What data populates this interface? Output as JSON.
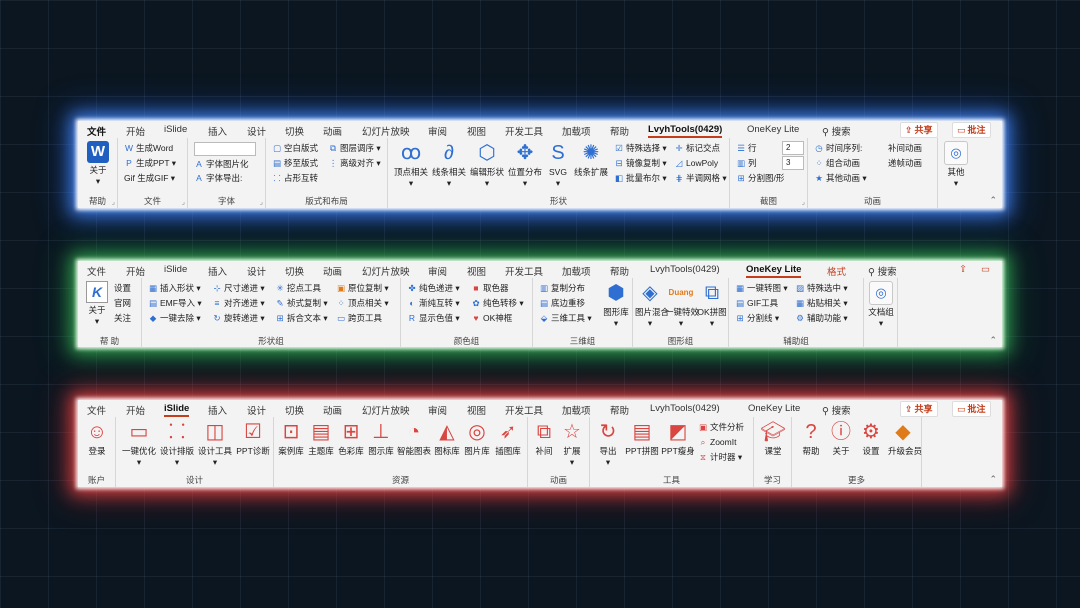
{
  "r1": {
    "tabs": [
      "文件",
      "开始",
      "iSlide",
      "插入",
      "设计",
      "切换",
      "动画",
      "幻灯片放映",
      "审阅",
      "视图",
      "开发工具",
      "加载项",
      "帮助",
      "LvyhTools(0429)",
      "OneKey Lite"
    ],
    "search": "搜索",
    "share": "共享",
    "comment": "批注",
    "groups": {
      "help": "帮助",
      "file": "文件",
      "font": "字体",
      "layout": "版式和布局",
      "shape": "形状",
      "screenshot": "截图",
      "anim": "动画"
    },
    "help": {
      "about": "关于"
    },
    "file": {
      "word": "生成Word",
      "ppt": "生成PPT",
      "gif": "Gif 生成GIF"
    },
    "font": {
      "select": "",
      "pic": "字体图片化",
      "export": "字体导出:"
    },
    "layout": {
      "blank": "空白版式",
      "move": "移至版式",
      "swap": "占形互转",
      "layer": "图层调序",
      "align": "离级对齐"
    },
    "shape": {
      "vertex": "顶点相关",
      "line": "线条相关",
      "edit": "编辑形状",
      "pos": "位置分布",
      "svg": "SVG",
      "expand": "线条扩展",
      "special": "特殊选择",
      "mirror": "镜像复制",
      "bool": "批量布尔",
      "mark": "标记交点",
      "lowpoly": "LowPoly",
      "grid": "半调网格"
    },
    "shot": {
      "row": "行",
      "col": "列",
      "split": "分割图/形",
      "rowval": "2",
      "colval": "3"
    },
    "anim": {
      "timeline": "时间序列:",
      "combo": "组合动画",
      "other": "其他动画",
      "tween": "补间动画",
      "chain": "递帧动画"
    },
    "more": {
      "other": "其他"
    }
  },
  "r2": {
    "tabs": [
      "文件",
      "开始",
      "iSlide",
      "插入",
      "设计",
      "切换",
      "动画",
      "幻灯片放映",
      "审阅",
      "视图",
      "开发工具",
      "加载项",
      "帮助",
      "LvyhTools(0429)",
      "OneKey Lite",
      "格式"
    ],
    "search": "搜索",
    "groups": {
      "help": "帮 助",
      "shape": "形状组",
      "color": "颜色组",
      "three": "三维组",
      "image": "图形组",
      "aux": "辅助组"
    },
    "help": {
      "about": "关于",
      "settings": "设置",
      "site": "官网",
      "follow": "关注"
    },
    "shape": {
      "insert": "插入形状",
      "emf": "EMF导入",
      "remove": "一键去除",
      "size": "尺寸递进",
      "alignp": "对齐递进",
      "rotate": "旋转递进",
      "cut": "挖点工具",
      "style": "祯式复制",
      "split": "拆合文本",
      "origin": "原位复制",
      "vertex": "顶点相关",
      "page": "跨页工具"
    },
    "color": {
      "pure": "纯色递进",
      "grad": "渐纯互转",
      "show": "显示色值",
      "pick": "取色器",
      "shift": "纯色转移",
      "ok": "OK神框"
    },
    "three": {
      "copy": "复制分布",
      "edge": "底边重移",
      "tool": "三维工具",
      "lib": "图形库"
    },
    "image": {
      "mix": "图片混合",
      "oneclick": "一键特效",
      "okpuzzle": "OK拼图",
      "duang": "Duang"
    },
    "aux": {
      "convert": "一键转图",
      "gif": "GIF工具",
      "sep": "分割线",
      "special": "特殊选中",
      "paste": "粘贴相关",
      "func": "辅助功能"
    },
    "doc": {
      "label": "文档组"
    }
  },
  "r3": {
    "tabs": [
      "文件",
      "开始",
      "iSlide",
      "插入",
      "设计",
      "切换",
      "动画",
      "幻灯片放映",
      "审阅",
      "视图",
      "开发工具",
      "加载项",
      "帮助",
      "LvyhTools(0429)",
      "OneKey Lite"
    ],
    "search": "搜索",
    "share": "共享",
    "comment": "批注",
    "groups": {
      "account": "账户",
      "design": "设计",
      "res": "资源",
      "anim": "动画",
      "tool": "工具",
      "learn": "学习",
      "more": "更多"
    },
    "account": {
      "login": "登录"
    },
    "design": {
      "opt": "一键优化",
      "arrange": "设计排版",
      "tool": "设计工具",
      "diag": "PPT诊断"
    },
    "res": {
      "case": "案例库",
      "theme": "主题库",
      "color": "色彩库",
      "diagram": "图示库",
      "smart": "智能图表",
      "icon": "图标库",
      "pic": "图片库",
      "illus": "插图库"
    },
    "anim": {
      "tween": "补间",
      "ext": "扩展"
    },
    "tool": {
      "export": "导出",
      "ppt": "PPT拼图",
      "slim": "PPT瘦身",
      "analyze": "文件分析",
      "zoom": "ZoomIt",
      "timer": "计时器"
    },
    "learn": {
      "course": "课堂"
    },
    "more": {
      "help": "帮助",
      "about": "关于",
      "settings": "设置",
      "vip": "升级会员"
    }
  }
}
